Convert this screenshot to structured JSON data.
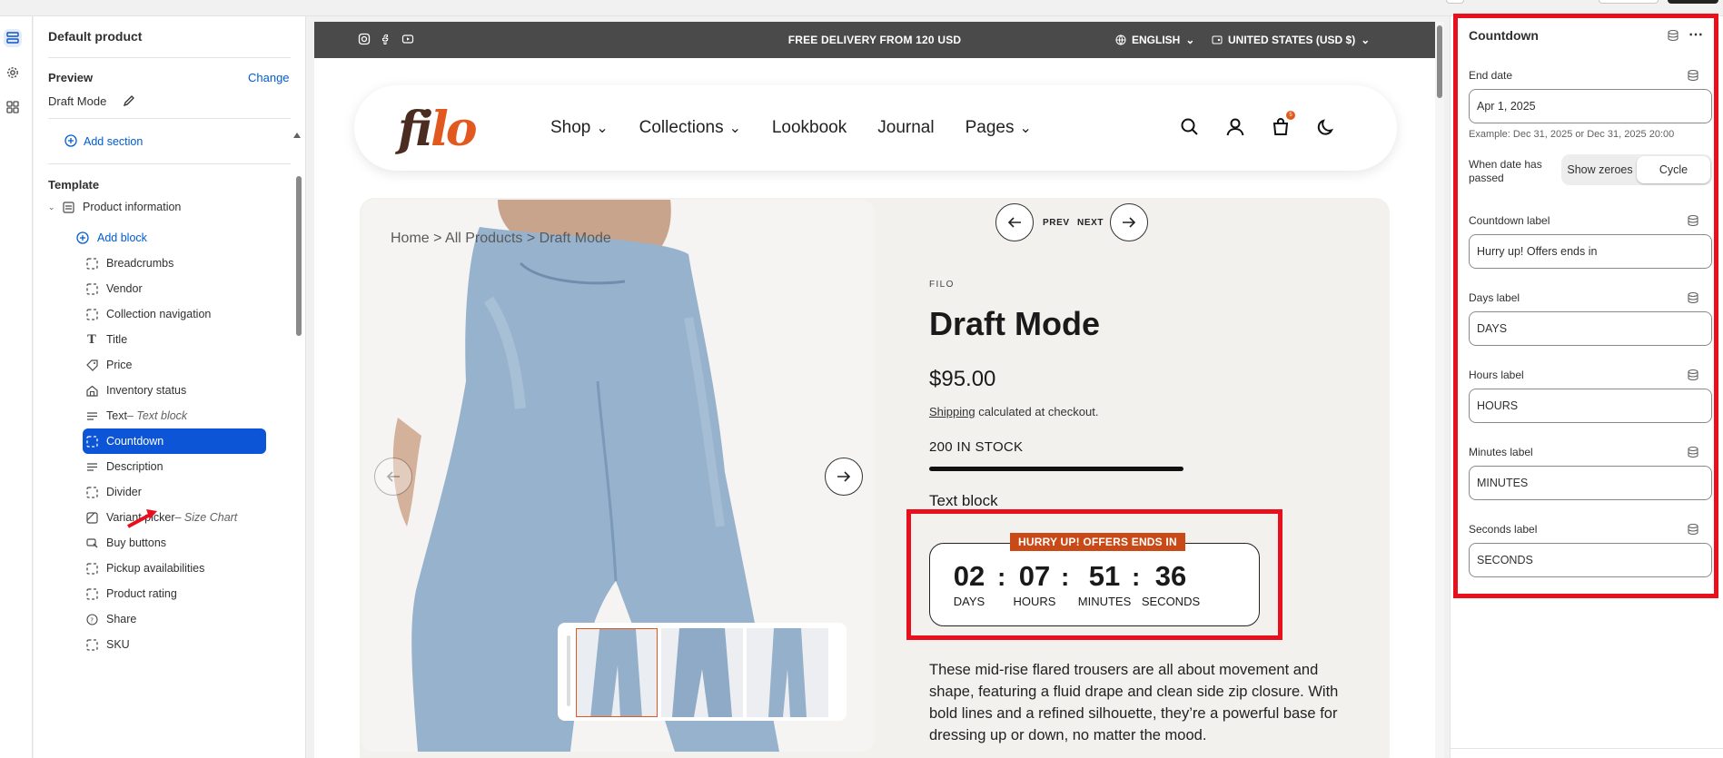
{
  "sidebar": {
    "title": "Default product",
    "preview_label": "Preview",
    "change_link": "Change",
    "preview_value": "Draft Mode",
    "add_section": "Add section",
    "template_label": "Template",
    "section_name": "Product information",
    "add_block": "Add block",
    "blocks": [
      {
        "label": "Breadcrumbs",
        "suffix": ""
      },
      {
        "label": "Vendor",
        "suffix": ""
      },
      {
        "label": "Collection navigation",
        "suffix": ""
      },
      {
        "label": "Title",
        "suffix": ""
      },
      {
        "label": "Price",
        "suffix": ""
      },
      {
        "label": "Inventory status",
        "suffix": ""
      },
      {
        "label": "Text",
        "suffix": " – Text block"
      },
      {
        "label": "Countdown",
        "suffix": ""
      },
      {
        "label": "Description",
        "suffix": ""
      },
      {
        "label": "Divider",
        "suffix": ""
      },
      {
        "label": "Variant picker",
        "suffix": " – Size Chart"
      },
      {
        "label": "Buy buttons",
        "suffix": ""
      },
      {
        "label": "Pickup availabilities",
        "suffix": ""
      },
      {
        "label": "Product rating",
        "suffix": ""
      },
      {
        "label": "Share",
        "suffix": ""
      },
      {
        "label": "SKU",
        "suffix": ""
      }
    ]
  },
  "store": {
    "announcement": "FREE DELIVERY FROM 120 USD",
    "language": "ENGLISH",
    "currency": "UNITED STATES (USD $)",
    "logo_dark": "fi",
    "logo_accent": "lo",
    "nav": [
      "Shop",
      "Collections",
      "Lookbook",
      "Journal",
      "Pages"
    ],
    "cart_count": "5",
    "breadcrumb": "Home  >  All Products  >  Draft Mode",
    "prev": "PREV",
    "next": "NEXT",
    "vendor": "FILO",
    "product_title": "Draft Mode",
    "price": "$95.00",
    "shipping_link": "Shipping",
    "shipping_rest": " calculated at checkout.",
    "stock": "200 IN STOCK",
    "text_block": "Text block",
    "countdown": {
      "tag": "HURRY UP! OFFERS ENDS IN",
      "days": "02",
      "hours": "07",
      "minutes": "51",
      "seconds": "36",
      "days_label": "DAYS",
      "hours_label": "HOURS",
      "minutes_label": "MINUTES",
      "seconds_label": "SECONDS"
    },
    "description": "These mid-rise flared trousers are all about movement and shape, featuring a fluid drape and clean side zip closure. With bold lines and a refined silhouette, they’re a powerful base for dressing up or down, no matter the mood."
  },
  "settings": {
    "title": "Countdown",
    "end_date_label": "End date",
    "end_date_value": "Apr 1, 2025",
    "end_date_help": "Example: Dec 31, 2025 or Dec 31, 2025 20:00",
    "passed_label": "When date has passed",
    "passed_options": [
      "Show zeroes",
      "Cycle"
    ],
    "passed_selected": "Cycle",
    "countdown_label": "Countdown label",
    "countdown_value": "Hurry up! Offers ends in",
    "days_label": "Days label",
    "days_value": "DAYS",
    "hours_label": "Hours label",
    "hours_value": "HOURS",
    "minutes_label": "Minutes label",
    "minutes_value": "MINUTES",
    "seconds_label": "Seconds label",
    "seconds_value": "SECONDS"
  },
  "colors": {
    "accent_blue": "#0b55d6",
    "highlight_red": "#e8101c",
    "brand_orange": "#e2591f",
    "tag_orange": "#c94a16"
  }
}
